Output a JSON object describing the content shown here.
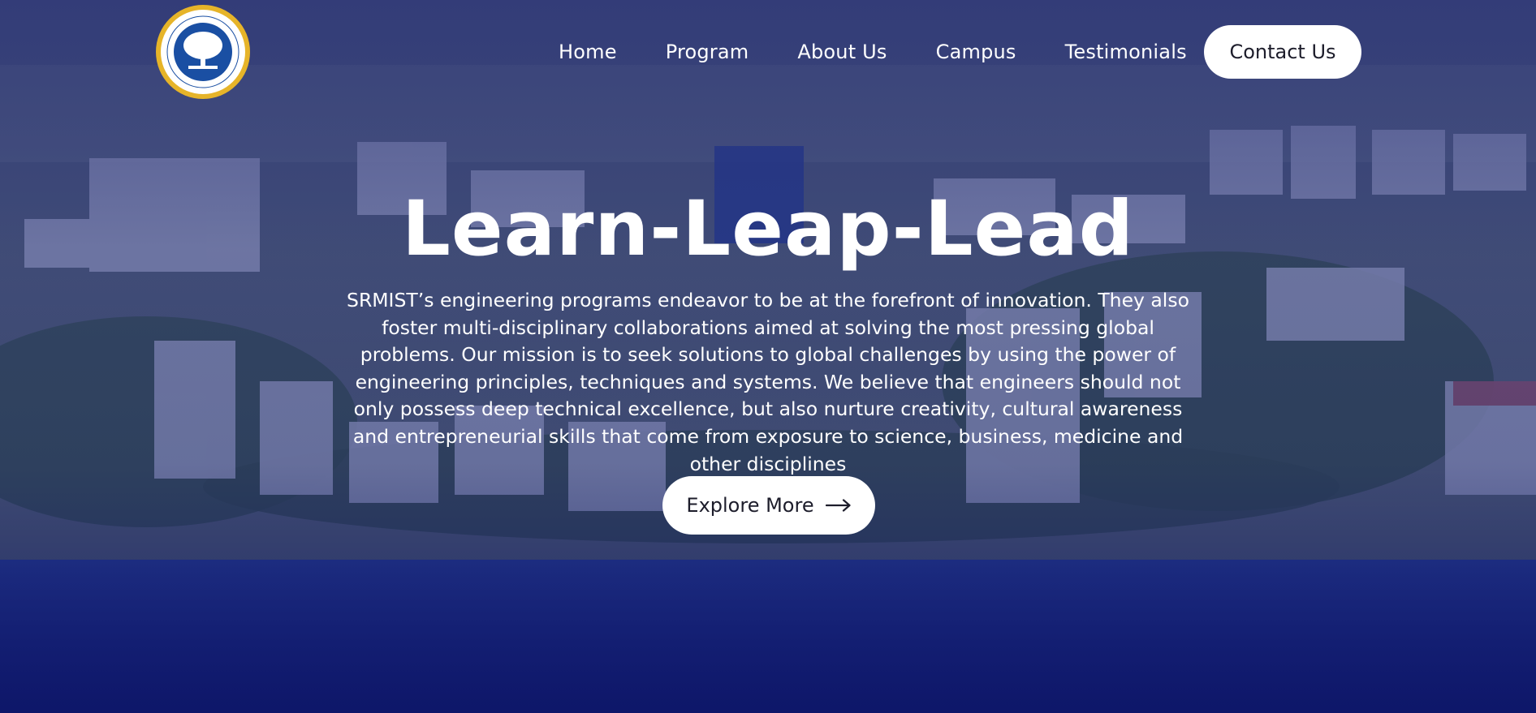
{
  "brand": {
    "logo_name": "srm-institute-seal"
  },
  "nav": {
    "items": [
      {
        "label": "Home"
      },
      {
        "label": "Program"
      },
      {
        "label": "About Us"
      },
      {
        "label": "Campus"
      },
      {
        "label": "Testimonials"
      }
    ],
    "contact_label": "Contact Us"
  },
  "hero": {
    "title": "Learn-Leap-Lead",
    "description": "SRMIST’s engineering programs endeavor to be at the forefront of innovation. They also foster multi-disciplinary collaborations aimed at solving the most pressing global problems. Our mission is to seek solutions to global challenges by using the power of engineering principles, techniques and systems. We believe that engineers should not only possess deep technical excellence, but also nurture creativity, cultural awareness and entrepreneurial skills that come from exposure to science, business, medicine and other disciplines",
    "cta_label": "Explore More",
    "cta_icon": "arrow-right-icon"
  },
  "colors": {
    "overlay": "#232c78",
    "button_bg": "#ffffff",
    "button_text": "#1d1d2b",
    "seal_gold": "#e6b429",
    "seal_blue": "#1a4fa3"
  }
}
